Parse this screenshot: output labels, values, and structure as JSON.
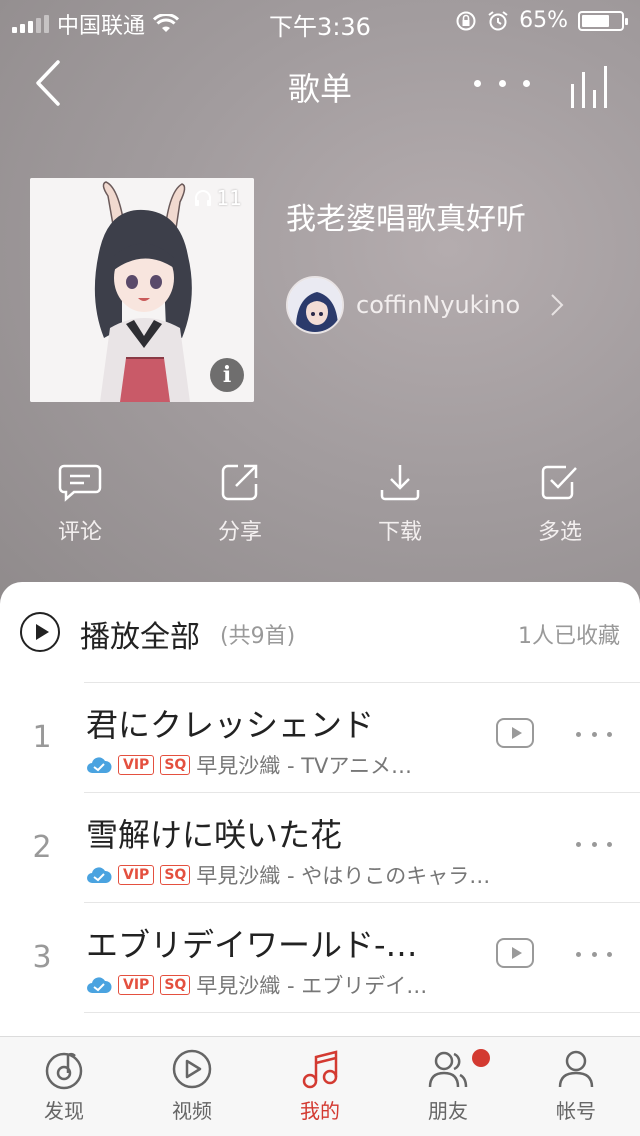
{
  "status_bar": {
    "carrier": "中国联通",
    "time": "下午3:36",
    "battery": "65%"
  },
  "header": {
    "title": "歌单"
  },
  "playlist": {
    "play_count": "11",
    "title": "我老婆唱歌真好听",
    "creator": "coffinNyukino"
  },
  "actions": [
    {
      "label": "评论"
    },
    {
      "label": "分享"
    },
    {
      "label": "下载"
    },
    {
      "label": "多选"
    }
  ],
  "list_header": {
    "play_all": "播放全部",
    "count": "(共9首)",
    "collected": "1人已收藏"
  },
  "songs": [
    {
      "index": "1",
      "title": "君にクレッシェンド",
      "vip": "VIP",
      "sq": "SQ",
      "meta": "早見沙織 - TVアニメ…",
      "has_mv": true
    },
    {
      "index": "2",
      "title": "雪解けに咲いた花",
      "vip": "VIP",
      "sq": "SQ",
      "meta": "早見沙織 - やはりこのキャラ…",
      "has_mv": false
    },
    {
      "index": "3",
      "title": "エブリデイワールド-…",
      "vip": "VIP",
      "sq": "SQ",
      "meta": "早見沙織 - エブリデイ…",
      "has_mv": true
    }
  ],
  "tabs": [
    {
      "label": "发现",
      "icon": "discover-icon"
    },
    {
      "label": "视频",
      "icon": "video-icon"
    },
    {
      "label": "我的",
      "icon": "music-icon",
      "active": true
    },
    {
      "label": "朋友",
      "icon": "friends-icon",
      "badge": true
    },
    {
      "label": "帐号",
      "icon": "account-icon"
    }
  ],
  "colors": {
    "accent": "#d33a31",
    "vip": "#e4503f",
    "cloud": "#4aa3e0"
  }
}
